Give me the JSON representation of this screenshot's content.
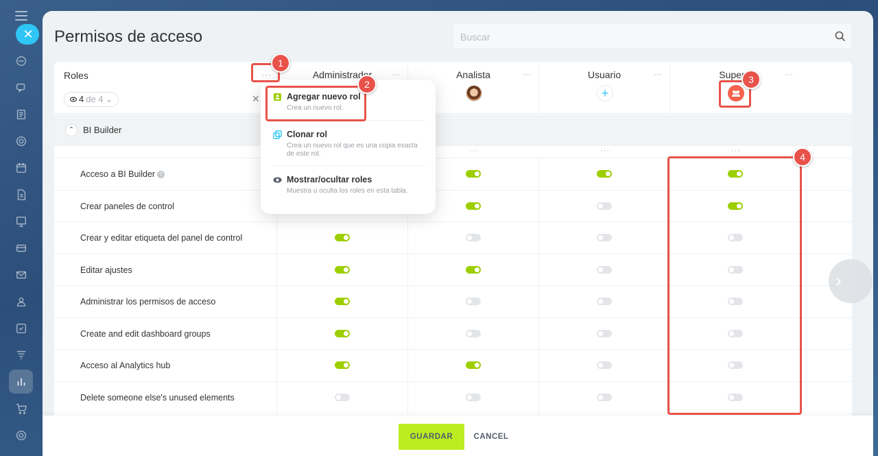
{
  "title": "Permisos de acceso",
  "search": {
    "placeholder": "Buscar"
  },
  "roles": {
    "label": "Roles",
    "counter_current": "4",
    "counter_rest": "de 4"
  },
  "columns": [
    {
      "name": "Administrador"
    },
    {
      "name": "Analista"
    },
    {
      "name": "Usuario"
    },
    {
      "name": "Supervi"
    }
  ],
  "section": {
    "label": "BI Builder"
  },
  "rows": [
    {
      "label": "Acceso a BI Builder",
      "toggles": [
        null,
        true,
        true,
        true
      ]
    },
    {
      "label": "Crear paneles de control",
      "toggles": [
        null,
        true,
        false,
        true
      ]
    },
    {
      "label": "Crear y editar etiqueta del panel de control",
      "toggles": [
        true,
        false,
        false,
        false
      ]
    },
    {
      "label": "Editar ajustes",
      "toggles": [
        true,
        true,
        false,
        false
      ]
    },
    {
      "label": "Administrar los permisos de acceso",
      "toggles": [
        true,
        false,
        false,
        false
      ]
    },
    {
      "label": "Create and edit dashboard groups",
      "toggles": [
        true,
        false,
        false,
        false
      ]
    },
    {
      "label": "Acceso al Analytics hub",
      "toggles": [
        true,
        true,
        false,
        false
      ]
    },
    {
      "label": "Delete someone else's unused elements",
      "toggles": [
        false,
        false,
        false,
        false
      ]
    }
  ],
  "menu": {
    "items": [
      {
        "title": "Agregar nuevo rol",
        "desc": "Crea un nuevo rol."
      },
      {
        "title": "Clonar rol",
        "desc": "Crea un nuevo rol que es una copia exacta de este rol."
      },
      {
        "title": "Mostrar/ocultar roles",
        "desc": "Muestra u oculta los roles en esta tabla."
      }
    ]
  },
  "footer": {
    "save": "GUARDAR",
    "cancel": "CANCEL"
  },
  "annotations": [
    "1",
    "2",
    "3",
    "4"
  ],
  "colors": {
    "accent": "#bbed21",
    "toggle_on": "#9dcf00",
    "highlight": "#e8524a",
    "link": "#2fc6f6"
  }
}
